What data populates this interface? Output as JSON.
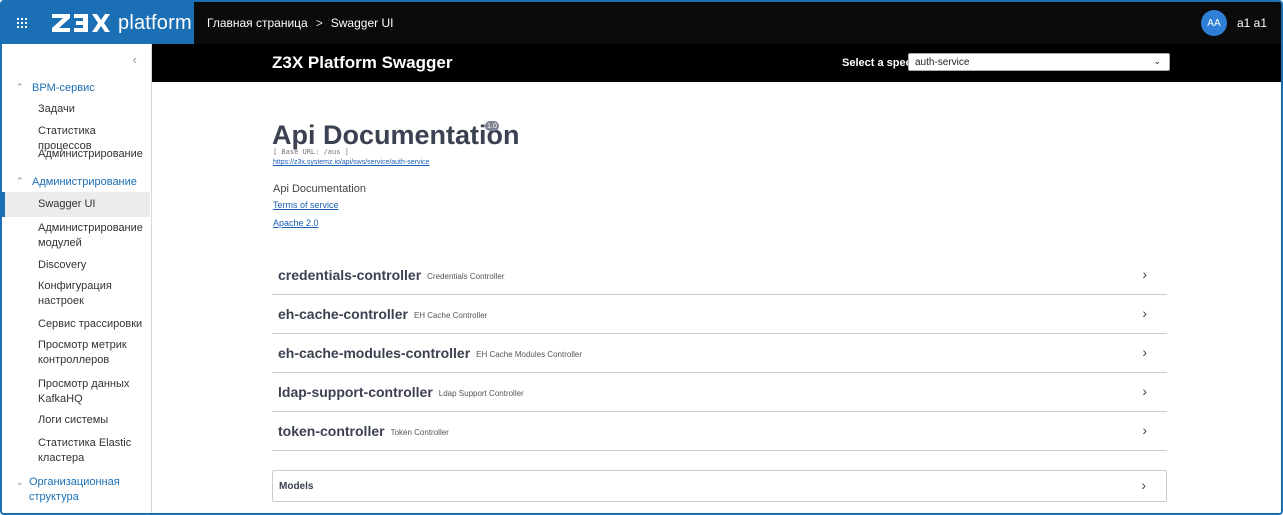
{
  "topbar": {
    "logo_text": "platform",
    "breadcrumb": [
      "Главная страница",
      "Swagger UI"
    ],
    "user_initials": "AA",
    "user_name": "a1 a1"
  },
  "sidebar": {
    "sections": [
      {
        "label": "BPM-сервис",
        "items": [
          "Задачи",
          "Статистика процессов",
          "Администрирование"
        ]
      },
      {
        "label": "Администрирование",
        "items": [
          "Swagger UI",
          "Администрирование модулей",
          "Discovery",
          "Конфигурация настроек",
          "Сервис трассировки",
          "Просмотр метрик контроллеров",
          "Просмотр данных KafkaHQ",
          "Логи системы",
          "Статистика Elastic кластера"
        ]
      },
      {
        "label": "Организационная структура",
        "items": []
      }
    ],
    "active_item": "Swagger UI"
  },
  "swagger": {
    "title": "Z3X Platform Swagger",
    "spec_label": "Select a spec",
    "spec_value": "auth-service",
    "api_title": "Api Documentation",
    "version": "1.0",
    "base_url": "[ Base URL: /aus ]",
    "api_url": "https://z3x.systemz.io/api/sws/service/auth-service",
    "description": "Api Documentation",
    "terms": "Terms of service",
    "license": "Apache 2.0",
    "controllers": [
      {
        "name": "credentials-controller",
        "desc": "Credentials Controller"
      },
      {
        "name": "eh-cache-controller",
        "desc": "EH Cache Controller"
      },
      {
        "name": "eh-cache-modules-controller",
        "desc": "EH Cache Modules Controller"
      },
      {
        "name": "ldap-support-controller",
        "desc": "Ldap Support Controller"
      },
      {
        "name": "token-controller",
        "desc": "Token Controller"
      }
    ],
    "models_label": "Models"
  },
  "colors": {
    "accent": "#1a6fb5",
    "topbar": "#0b0b0b",
    "swagger_bar": "#000000"
  }
}
